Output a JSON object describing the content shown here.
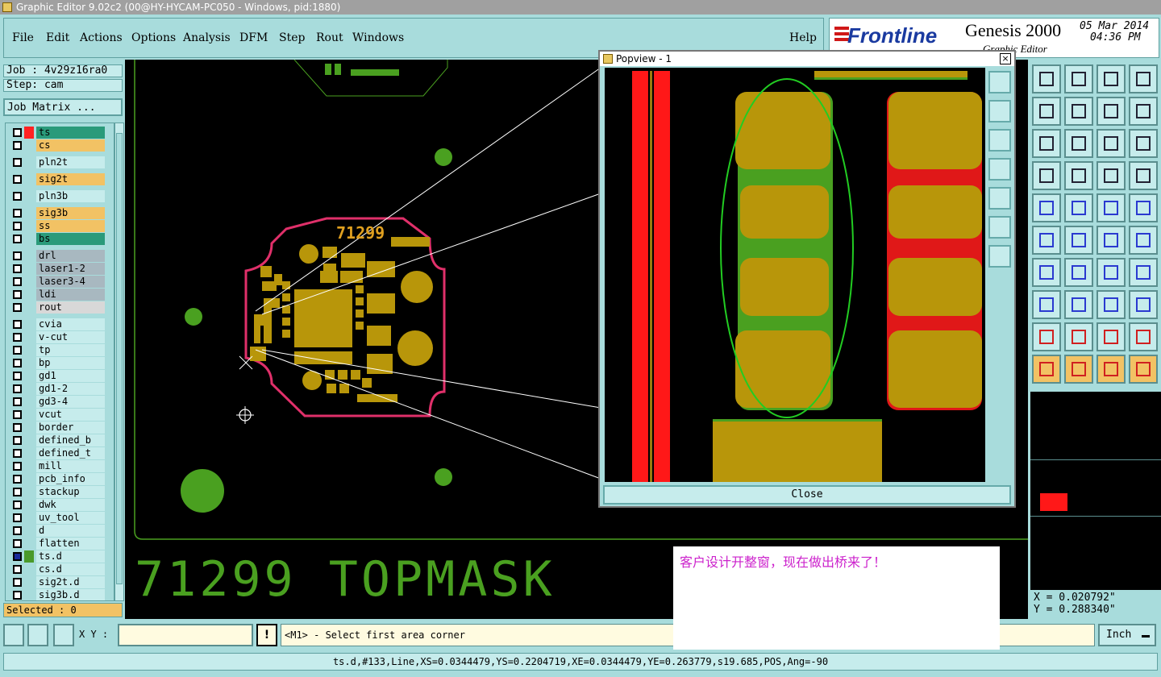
{
  "window": {
    "title": "Graphic Editor 9.02c2 (00@HY-HYCAM-PC050 - Windows, pid:1880)"
  },
  "menu": {
    "items": [
      "File",
      "Edit",
      "Actions",
      "Options",
      "Analysis",
      "DFM",
      "Step",
      "Rout",
      "Windows"
    ],
    "help": "Help"
  },
  "brand": {
    "logo": "Frontline",
    "product": "Genesis 2000",
    "date": "05 Mar 2014",
    "time": "04:36 PM",
    "subtitle": "Graphic Editor"
  },
  "job": {
    "job": "Job : 4v29z16ra0",
    "step": "Step: cam",
    "matrix": "Job Matrix ...",
    "selected": "Selected : 0"
  },
  "layers": [
    {
      "name": "ts",
      "bg": "#2a9a7a",
      "mark": "#ff2222"
    },
    {
      "name": "cs",
      "bg": "#f2c264"
    },
    {
      "name": "pln2t",
      "bg": "#c6ecec"
    },
    {
      "name": "sig2t",
      "bg": "#f2c264"
    },
    {
      "name": "pln3b",
      "bg": "#c6ecec"
    },
    {
      "name": "sig3b",
      "bg": "#f2c264"
    },
    {
      "name": "ss",
      "bg": "#f2c264"
    },
    {
      "name": "bs",
      "bg": "#2a9a7a"
    },
    {
      "name": "drl",
      "bg": "#a8b8c0"
    },
    {
      "name": "laser1-2",
      "bg": "#a8b8c0"
    },
    {
      "name": "laser3-4",
      "bg": "#a8b8c0"
    },
    {
      "name": "ldi",
      "bg": "#a8b8c0"
    },
    {
      "name": "rout",
      "bg": "#d8d8d8"
    },
    {
      "name": "cvia",
      "bg": "#c6ecec"
    },
    {
      "name": "v-cut",
      "bg": "#c6ecec"
    },
    {
      "name": "tp",
      "bg": "#c6ecec"
    },
    {
      "name": "bp",
      "bg": "#c6ecec"
    },
    {
      "name": "gd1",
      "bg": "#c6ecec"
    },
    {
      "name": "gd1-2",
      "bg": "#c6ecec"
    },
    {
      "name": "gd3-4",
      "bg": "#c6ecec"
    },
    {
      "name": "vcut",
      "bg": "#c6ecec"
    },
    {
      "name": "border",
      "bg": "#c6ecec"
    },
    {
      "name": "defined_b",
      "bg": "#c6ecec"
    },
    {
      "name": "defined_t",
      "bg": "#c6ecec"
    },
    {
      "name": "mill",
      "bg": "#c6ecec"
    },
    {
      "name": "pcb_info",
      "bg": "#c6ecec"
    },
    {
      "name": "stackup",
      "bg": "#c6ecec"
    },
    {
      "name": "dwk",
      "bg": "#c6ecec"
    },
    {
      "name": "uv_tool",
      "bg": "#c6ecec"
    },
    {
      "name": "d",
      "bg": "#c6ecec"
    },
    {
      "name": "flatten",
      "bg": "#c6ecec"
    },
    {
      "name": "ts.d",
      "bg": "#c6ecec",
      "mark": "#4a9a2a",
      "active": true
    },
    {
      "name": "cs.d",
      "bg": "#c6ecec"
    },
    {
      "name": "sig2t.d",
      "bg": "#c6ecec"
    },
    {
      "name": "sig3b.d",
      "bg": "#c6ecec"
    }
  ],
  "canvas": {
    "board_label": "71299",
    "bottom_text": "71299 TOPMASK"
  },
  "popview": {
    "title": "Popview - 1",
    "close": "Close",
    "close_x": "×"
  },
  "coords": {
    "x": "X = 0.020792\"",
    "y": "Y = 0.288340\""
  },
  "bottom": {
    "xy_label": "X Y :",
    "xy_value": "",
    "prompt": "<M1> - Select first area corner",
    "units": "Inch"
  },
  "status": {
    "line": "ts.d,#133,Line,XS=0.0344479,YS=0.2204719,XE=0.0344479,YE=0.263779,s19.685,POS,Ang=-90"
  },
  "note": {
    "text": "客户设计开整窗，现在做出桥来了！"
  },
  "colors": {
    "panel": "#a8dcdc",
    "copper": "#b8960a",
    "mask": "#4aa020",
    "outline": "#e0306a",
    "canvas": "#000000"
  }
}
